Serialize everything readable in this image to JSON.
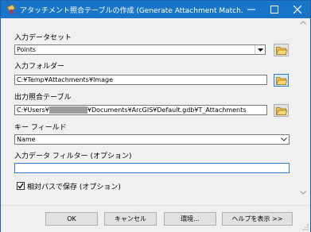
{
  "window": {
    "title": "アタッチメント照合テーブルの作成 (Generate Attachment Match...",
    "minimize_glyph": "—",
    "maximize_glyph": "☐",
    "close_glyph": "✕"
  },
  "form": {
    "input_dataset": {
      "label": "入力データセット",
      "value": "Points"
    },
    "input_folder": {
      "label": "入力フォルダー",
      "value": "C:¥Temp¥Attachments¥Image"
    },
    "output_table": {
      "label": "出力照合テーブル",
      "value_prefix": "C:¥Users¥",
      "value_suffix": "¥Documents¥ArcGIS¥Default.gdb¥T_Attachments"
    },
    "key_field": {
      "label": "キー フィールド",
      "value": "Name"
    },
    "filter": {
      "label": "入力データ フィルター (オプション)",
      "value": ""
    },
    "relative_path": {
      "label": "相対パスで保存 (オプション)",
      "checked": true,
      "check_glyph": "✓"
    }
  },
  "buttons": {
    "ok": "OK",
    "cancel": "キャンセル",
    "environments": "環境...",
    "show_help": "ヘルプを表示 >>"
  },
  "icons": {
    "app": "toolbox-icon",
    "folder": "open-folder-icon",
    "dropdown": "chevron-down-icon"
  },
  "colors": {
    "titlebar": "#1975c7",
    "window_bg": "#f0f0f0",
    "redaction": "#9c9c9c",
    "focused_border": "#2b7bd1"
  }
}
